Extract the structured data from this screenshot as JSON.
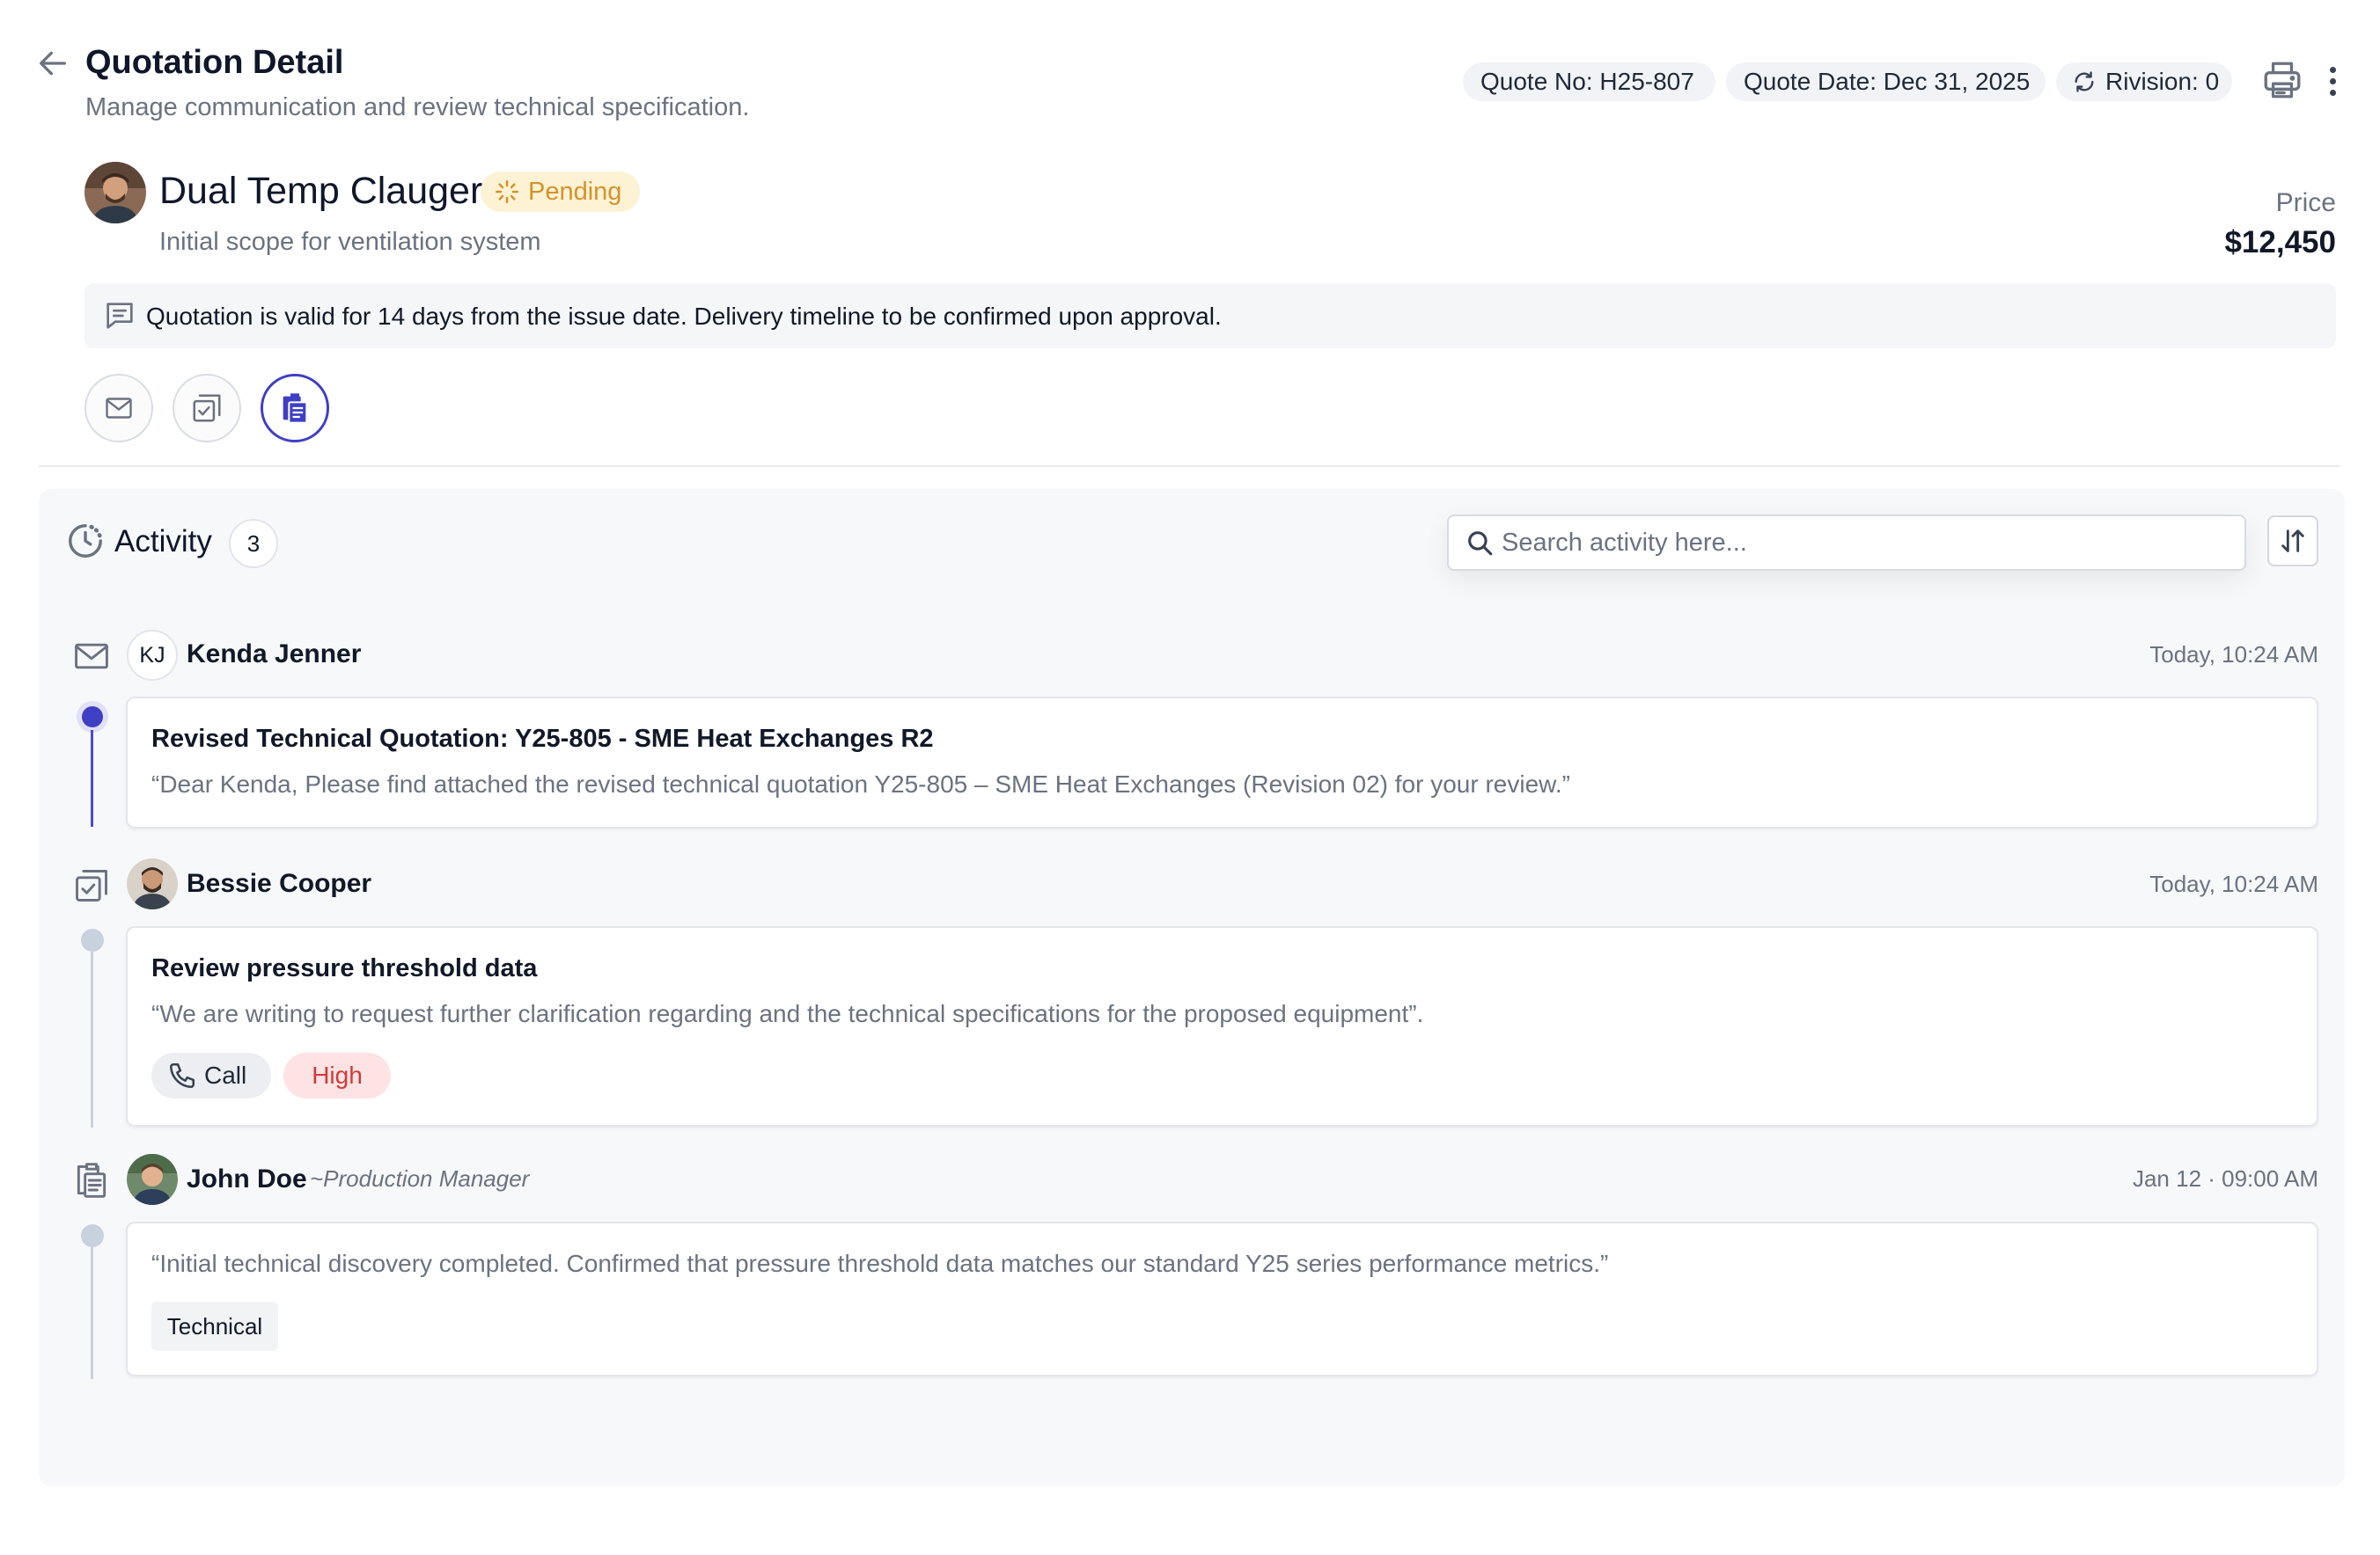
{
  "header": {
    "title": "Quotation Detail",
    "subtitle": "Manage communication and review technical specification.",
    "quote_no": "Quote No: H25-807",
    "quote_date": "Quote Date: Dec 31, 2025",
    "revision": "Rivision: 0"
  },
  "customer": {
    "name": "Dual Temp Clauger",
    "status": "Pending",
    "description": "Initial scope for ventilation system",
    "price_label": "Price",
    "price": "$12,450"
  },
  "note": {
    "text": "Quotation is valid for 14 days from the issue date. Delivery timeline to be confirmed upon approval."
  },
  "action_buttons": [
    "mail-icon",
    "task-icon",
    "notes-icon"
  ],
  "activity": {
    "title": "Activity",
    "count": "3",
    "search_placeholder": "Search activity here...",
    "items": [
      {
        "type": "email",
        "initials": "KJ",
        "author": "Kenda Jenner",
        "time": "Today, 10:24 AM",
        "title": "Revised Technical Quotation: Y25-805 - SME Heat Exchanges R2",
        "body": "“Dear Kenda, Please find attached the revised technical quotation Y25-805 – SME Heat Exchanges (Revision 02) for your review.”"
      },
      {
        "type": "task",
        "author": "Bessie Cooper",
        "time": "Today, 10:24 AM",
        "title": "Review pressure threshold data",
        "body": "“We are writing to request further clarification regarding and the technical specifications for the proposed equipment”.",
        "tags": [
          "Call",
          "High"
        ]
      },
      {
        "type": "note",
        "author": "John Doe",
        "role": "~Production Manager",
        "time": "Jan 12 · 09:00 AM",
        "body": "“Initial technical discovery completed. Confirmed that pressure threshold data matches our standard Y25 series performance metrics.”",
        "tags": [
          "Technical"
        ]
      }
    ]
  },
  "colors": {
    "accent": "#3f3fc4",
    "pending_bg": "#fdf2d4",
    "pending_text": "#d4932b",
    "high_bg": "#fde3e3",
    "high_text": "#cf3b3b",
    "panel_bg": "#f7f8fa"
  }
}
